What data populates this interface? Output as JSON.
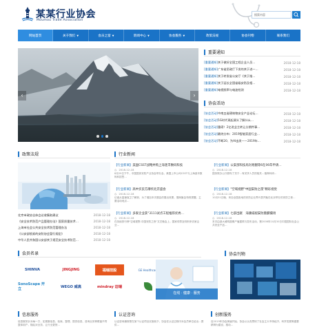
{
  "header": {
    "title": "某某行业协会",
    "subtitle": "Moumou Trade Association",
    "search_placeholder": "搜索内容"
  },
  "nav": {
    "items": [
      {
        "label": "网站首页",
        "active": true,
        "arrow": false
      },
      {
        "label": "关于我们",
        "active": false,
        "arrow": true
      },
      {
        "label": "会员之窗",
        "active": false,
        "arrow": true
      },
      {
        "label": "新闻中心",
        "active": false,
        "arrow": true
      },
      {
        "label": "协会服务",
        "active": false,
        "arrow": true
      },
      {
        "label": "政策法规",
        "active": false,
        "arrow": false
      },
      {
        "label": "协会刊物",
        "active": false,
        "arrow": false
      },
      {
        "label": "联系我们",
        "active": false,
        "arrow": false
      }
    ],
    "arrow_glyph": "▼"
  },
  "notice": {
    "title": "重要通知",
    "items": [
      {
        "tag": "[重要通知]",
        "text": "关于做好全国工程企业人员…",
        "date": "2018-12-18"
      },
      {
        "tag": "[重要通知]",
        "text": "广东省民政厅下发的关于进一…",
        "date": "2018-12-18"
      },
      {
        "tag": "[重要通知]",
        "text": "关于转发省公安厅《关于推…",
        "date": "2018-12-18"
      },
      {
        "tag": "[重要通知]",
        "text": "关于延长全国省级安防及相…",
        "date": "2018-12-18"
      },
      {
        "tag": "[重要通知]",
        "text": "电视频率与电波检测",
        "date": "2018-12-18"
      }
    ]
  },
  "activity": {
    "title": "协会活动",
    "items": [
      {
        "tag": "[协会活动]",
        "text": "中南五省建筑物安全产业论坛…",
        "date": "2018-12-18"
      },
      {
        "tag": "[协会活动]",
        "text": "5G时代再起源头了解什么…",
        "date": "2018-12-18"
      },
      {
        "tag": "[协会活动]",
        "text": "重磅！2亿进业主转让分期件事…",
        "date": "2018-12-18"
      },
      {
        "tag": "[协会活动]",
        "text": "最终分布：2019智能家居行业…",
        "date": "2018-12-18"
      },
      {
        "tag": "[协会活动]",
        "text": "不断20、为AI出发——2019年…",
        "date": "2018-12-18"
      }
    ]
  },
  "policy": {
    "title": "政策法规",
    "items": [
      {
        "text": "北京市政协全体会议收集取建议",
        "date": "2018-12-18"
      },
      {
        "text": "《安全技术防范产品管理办法》国家质量技术…",
        "date": "2018-12-18"
      },
      {
        "text": "上海市社会公共安全技术防范管理办法",
        "date": "2018-12-18"
      },
      {
        "text": "《公安部锁紧的安防协会暂行规定》",
        "date": "2018-12-18"
      },
      {
        "text": "中华人民共和国公安部关于规范安全技术防范…",
        "date": "2018-12-18"
      }
    ]
  },
  "news": {
    "title": "行业新闻",
    "items": [
      {
        "tag": "【行业新闻】",
        "title": "美国CSST战略并购上海逐丰数码科技",
        "date": "2018-12-18",
        "body": "8月29日下午，中国国安安防产业协会举办会，美国上市公司CSST与上海逐丰数码科技签…"
      },
      {
        "tag": "【行业新闻】",
        "title": "公安部科技局对易翻等6在06年申请…",
        "date": "2018-12-18",
        "body": "国务院办公厅颁布了关于…有关学人员的相关…推荐科研…"
      },
      {
        "tag": "【行业新闻】",
        "title": "高中买卖方摩托北京盛会",
        "date": "2018-12-18",
        "body": "记者从高速保卫了解到，为了增加本次展会的展出效果，展商聚会特别提醒，主要活动地点…"
      },
      {
        "tag": "【行业新闻】",
        "title": "\"空域视野\"中国安防之夜\"精彩视觉",
        "date": "2018-12-18",
        "body": "10月31日晚，来自全国各地的安防企业界代表齐聚在北京举办的安防之夜…"
      },
      {
        "tag": "【行业新闻】",
        "title": "多家企业获\"3111试点工程推荐优秀…",
        "date": "2018-12-18",
        "body": "在持续排行榜\"空域视野-中国安防之夜\"文艺晚会上，国家领导及特别来访家企业…"
      },
      {
        "tag": "【行业新闻】",
        "title": "七部出献　海康威视安防重麟摄场",
        "date": "2018-12-18",
        "body": "本次由部大威鸣摄像产值建筑与发布活动，第2006年10月30日中国国际社会公共安全产品…"
      }
    ]
  },
  "members": {
    "title": "会员名录",
    "logos": [
      {
        "name": "SHINVA",
        "color": "#1f4f9c"
      },
      {
        "name": "JINGJING",
        "color": "#d0202a"
      },
      {
        "name": "福瑞控股",
        "color": "#ffffff"
      },
      {
        "name": "GE Healthcare",
        "color": "#2e6db5"
      },
      {
        "name": "SonoScape 开立",
        "color": "#1b80c4"
      },
      {
        "name": "WEGO 威高",
        "color": "#1f4f9c"
      },
      {
        "name": "mindray 迈瑞",
        "color": "#d0202a"
      },
      {
        "name": "",
        "color": "#3a8a3a"
      }
    ]
  },
  "journal": {
    "title": "协会刊物",
    "caption": "在线 · 健康 · 服务"
  },
  "bottom": {
    "info": {
      "title": "信息服务",
      "text": "信息服务针对每一方，如搜集信息、检索、整理、提供信息、咨询业务等覆盖不同整体用户，随后对业务、让行业更快…"
    },
    "cert": {
      "title": "认证咨询",
      "text": "认证咨询通常是在某个认证项目实施前夕，协会在认证过程中对会员单位给出…提供…"
    },
    "innov": {
      "title": "创新服务",
      "text": "自2019年协会换届开始，协会以认真贯彻了社会主义市场经济、科学发展等重要精神为建设，推动…"
    }
  }
}
